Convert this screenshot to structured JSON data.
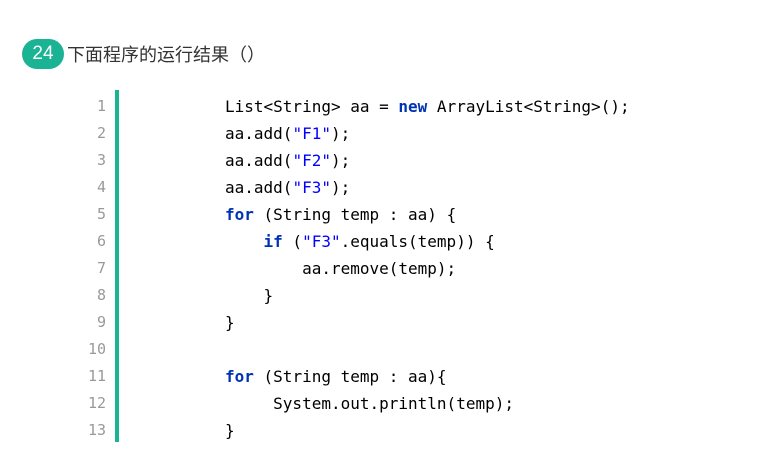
{
  "question": {
    "number": "24",
    "title": "下面程序的运行结果（）"
  },
  "colors": {
    "accent": "#1ab394",
    "keyword": "#0033b3",
    "string": "#0000ff",
    "line_number": "#999999"
  },
  "code": {
    "language": "java",
    "lines": [
      {
        "number": "1",
        "tokens": [
          {
            "t": "List<String> aa = "
          },
          {
            "t": "new",
            "c": "kw"
          },
          {
            "t": " ArrayList<String>();"
          }
        ]
      },
      {
        "number": "2",
        "tokens": [
          {
            "t": "aa.add("
          },
          {
            "t": "\"F1\"",
            "c": "str"
          },
          {
            "t": ");"
          }
        ]
      },
      {
        "number": "3",
        "tokens": [
          {
            "t": "aa.add("
          },
          {
            "t": "\"F2\"",
            "c": "str"
          },
          {
            "t": ");"
          }
        ]
      },
      {
        "number": "4",
        "tokens": [
          {
            "t": "aa.add("
          },
          {
            "t": "\"F3\"",
            "c": "str"
          },
          {
            "t": ");"
          }
        ]
      },
      {
        "number": "5",
        "tokens": [
          {
            "t": "for",
            "c": "kw"
          },
          {
            "t": " (String temp : aa) {"
          }
        ]
      },
      {
        "number": "6",
        "tokens": [
          {
            "t": "    "
          },
          {
            "t": "if",
            "c": "kw"
          },
          {
            "t": " ("
          },
          {
            "t": "\"F3\"",
            "c": "str"
          },
          {
            "t": ".equals(temp)) {"
          }
        ]
      },
      {
        "number": "7",
        "tokens": [
          {
            "t": "        aa.remove(temp);"
          }
        ]
      },
      {
        "number": "8",
        "tokens": [
          {
            "t": "    }"
          }
        ]
      },
      {
        "number": "9",
        "tokens": [
          {
            "t": "}"
          }
        ]
      },
      {
        "number": "10",
        "tokens": []
      },
      {
        "number": "11",
        "tokens": [
          {
            "t": "for",
            "c": "kw"
          },
          {
            "t": " (String temp : aa){"
          }
        ]
      },
      {
        "number": "12",
        "tokens": [
          {
            "t": "     System.out.println(temp);"
          }
        ]
      },
      {
        "number": "13",
        "tokens": [
          {
            "t": "}"
          }
        ]
      }
    ]
  }
}
